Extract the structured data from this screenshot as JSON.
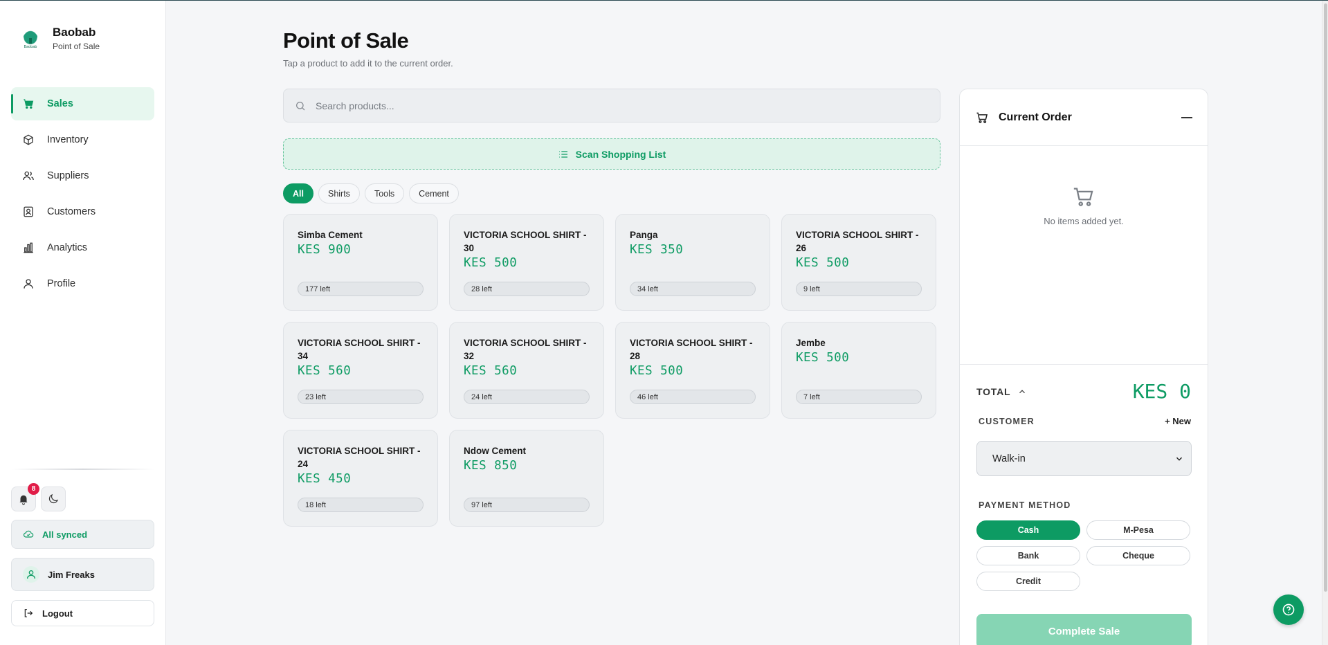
{
  "brand": {
    "name": "Baobab",
    "subtitle": "Point of Sale",
    "logo_text": "Baobab"
  },
  "sidebar": {
    "items": [
      {
        "label": "Sales",
        "icon": "cart-icon",
        "active": true
      },
      {
        "label": "Inventory",
        "icon": "box-icon",
        "active": false
      },
      {
        "label": "Suppliers",
        "icon": "users-icon",
        "active": false
      },
      {
        "label": "Customers",
        "icon": "contact-icon",
        "active": false
      },
      {
        "label": "Analytics",
        "icon": "bar-chart-icon",
        "active": false
      },
      {
        "label": "Profile",
        "icon": "user-icon",
        "active": false
      }
    ],
    "notification_count": "8",
    "sync_status": "All synced",
    "user_name": "Jim Freaks",
    "logout_label": "Logout"
  },
  "header": {
    "title": "Point of Sale",
    "subtitle": "Tap a product to add it to the current order."
  },
  "search": {
    "placeholder": "Search products...",
    "value": ""
  },
  "scan_label": "Scan Shopping List",
  "filters": [
    "All",
    "Shirts",
    "Tools",
    "Cement"
  ],
  "active_filter": "All",
  "products": [
    {
      "name": "Simba Cement",
      "price": "KES 900",
      "stock": "177 left"
    },
    {
      "name": "VICTORIA SCHOOL SHIRT - 30",
      "price": "KES 500",
      "stock": "28 left"
    },
    {
      "name": "Panga",
      "price": "KES 350",
      "stock": "34 left"
    },
    {
      "name": "VICTORIA SCHOOL SHIRT - 26",
      "price": "KES 500",
      "stock": "9 left"
    },
    {
      "name": "VICTORIA SCHOOL SHIRT - 34",
      "price": "KES 560",
      "stock": "23 left"
    },
    {
      "name": "VICTORIA SCHOOL SHIRT - 32",
      "price": "KES 560",
      "stock": "24 left"
    },
    {
      "name": "VICTORIA SCHOOL SHIRT - 28",
      "price": "KES 500",
      "stock": "46 left"
    },
    {
      "name": "Jembe",
      "price": "KES 500",
      "stock": "7 left"
    },
    {
      "name": "VICTORIA SCHOOL SHIRT - 24",
      "price": "KES 450",
      "stock": "18 left"
    },
    {
      "name": "Ndow Cement",
      "price": "KES 850",
      "stock": "97 left"
    }
  ],
  "order": {
    "title": "Current Order",
    "empty_text": "No items added yet.",
    "total_label": "TOTAL",
    "total_value": "KES 0",
    "customer_label": "CUSTOMER",
    "new_customer_label": "+ New",
    "customer_selected": "Walk-in",
    "payment_label": "PAYMENT METHOD",
    "payment_methods": [
      "Cash",
      "M-Pesa",
      "Bank",
      "Cheque",
      "Credit"
    ],
    "payment_selected": "Cash",
    "complete_label": "Complete Sale"
  },
  "colors": {
    "accent": "#0d9b63",
    "accent_light": "#e7f7ef",
    "badge": "#e11d48"
  }
}
